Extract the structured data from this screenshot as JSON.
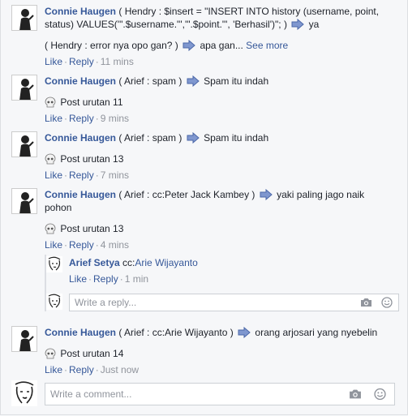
{
  "comments": [
    {
      "author": "Connie Haugen",
      "text_a": "( Hendry : $insert = \"INSERT INTO history (username, point, status) VALUES('\".$username.\"','\".$point.\"', 'Berhasil')\"; )",
      "text_b": "ya",
      "text_c": "( Hendry : error nya opo gan? )",
      "text_d": "apa gan...",
      "see_more": "See more",
      "like": "Like",
      "reply": "Reply",
      "time": "11 mins"
    },
    {
      "author": "Connie Haugen",
      "text_a": "( Arief : spam )",
      "text_b": "Spam itu indah",
      "post": "Post urutan 11",
      "like": "Like",
      "reply": "Reply",
      "time": "9 mins"
    },
    {
      "author": "Connie Haugen",
      "text_a": "( Arief : spam )",
      "text_b": "Spam itu indah",
      "post": "Post urutan 13",
      "like": "Like",
      "reply": "Reply",
      "time": "7 mins"
    },
    {
      "author": "Connie Haugen",
      "text_a": "( Arief : cc:Peter Jack Kambey )",
      "text_b": "yaki paling jago naik pohon",
      "post": "Post urutan 13",
      "like": "Like",
      "reply": "Reply",
      "time": "4 mins"
    },
    {
      "author": "Connie Haugen",
      "text_a": "( Arief : cc:Arie Wijayanto )",
      "text_b": "orang arjosari yang nyebelin",
      "post": "Post urutan 14",
      "like": "Like",
      "reply": "Reply",
      "time": "Just now"
    }
  ],
  "reply": {
    "author": "Arief Setya",
    "prefix": "cc:",
    "mention": "Arie Wijayanto",
    "like": "Like",
    "reply": "Reply",
    "time": "1 min"
  },
  "reply_input": {
    "placeholder": "Write a reply..."
  },
  "comment_input": {
    "placeholder": "Write a comment..."
  },
  "icons": {
    "arrow": "right-arrow-emoji",
    "skull": "skull-emoji",
    "camera": "camera-icon",
    "emoji": "smiley-icon"
  },
  "colors": {
    "link": "#365899",
    "meta": "#90949c",
    "arrow": "#5b7cc2"
  }
}
